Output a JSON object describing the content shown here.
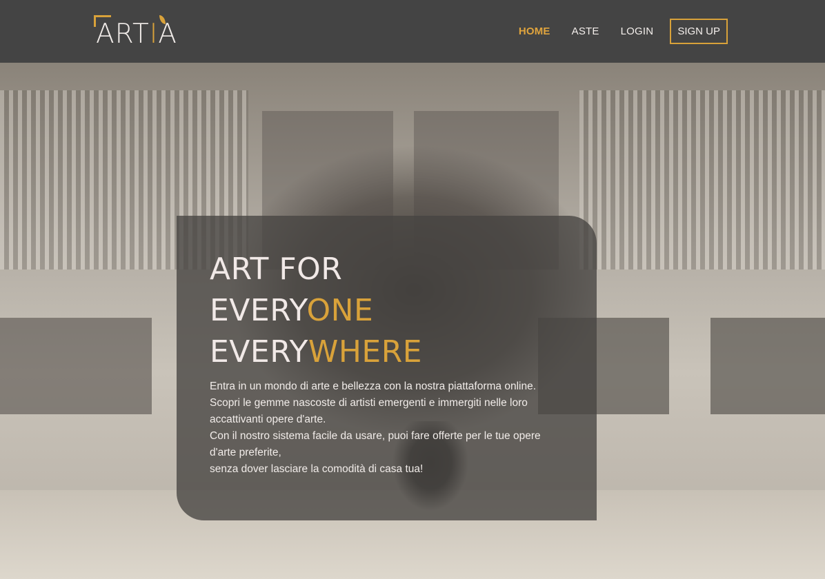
{
  "brand": {
    "logo_prefix": "ART",
    "logo_i": "I",
    "logo_suffix": "A",
    "accent_color": "#d9a23a"
  },
  "nav": {
    "items": [
      {
        "label": "HOME",
        "active": true
      },
      {
        "label": "ASTE",
        "active": false
      },
      {
        "label": "LOGIN",
        "active": false
      }
    ],
    "signup_label": "SIGN UP"
  },
  "hero": {
    "headline": {
      "line1": "ART FOR",
      "line2_main": "EVERY",
      "line2_accent": "ONE",
      "line3_main": "EVERY",
      "line3_accent": "WHERE"
    },
    "description": [
      "Entra in un mondo di arte e bellezza con la nostra piattaforma online.",
      "Scopri le gemme nascoste di artisti emergenti e immergiti nelle loro accattivanti opere d'arte.",
      "Con il nostro sistema facile da usare, puoi fare offerte per le tue opere d'arte preferite,",
      "senza dover lasciare la comodità di casa tua!"
    ],
    "background_image": "blurred art gallery corridor with person"
  }
}
